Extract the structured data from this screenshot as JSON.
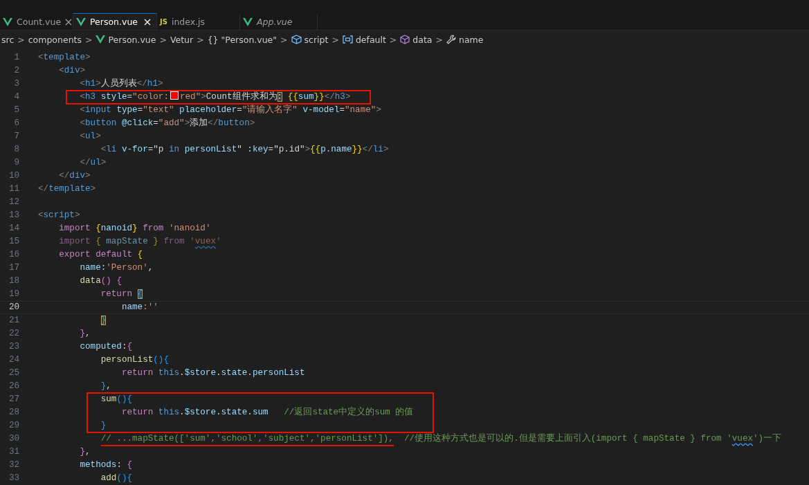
{
  "tabs": [
    {
      "label": "Count.vue",
      "kind": "vue",
      "selected": false,
      "preview": false,
      "closable": true
    },
    {
      "label": "Person.vue",
      "kind": "vue",
      "selected": true,
      "preview": false,
      "closable": true
    },
    {
      "label": "index.js",
      "kind": "js",
      "icon_text": "JS",
      "selected": false,
      "preview": false,
      "closable": false
    },
    {
      "label": "App.vue",
      "kind": "vue",
      "selected": false,
      "preview": true,
      "closable": false
    }
  ],
  "breadcrumb": [
    {
      "label": "src",
      "kind": "plain"
    },
    {
      "label": "components",
      "kind": "plain"
    },
    {
      "label": "Person.vue",
      "kind": "vue"
    },
    {
      "label": "Vetur",
      "kind": "plain"
    },
    {
      "label": "\"Person.vue\"",
      "kind": "plain",
      "icon_text": "{}"
    },
    {
      "label": "script",
      "kind": "cube"
    },
    {
      "label": "default",
      "kind": "module"
    },
    {
      "label": "data",
      "kind": "box"
    },
    {
      "label": "name",
      "kind": "wrench"
    }
  ],
  "separator": ">",
  "lines": [
    {
      "number": "1",
      "tokens": [
        {
          "kind": "p",
          "text": "<"
        },
        {
          "kind": "tag",
          "text": "template"
        },
        {
          "kind": "p",
          "text": ">"
        }
      ]
    },
    {
      "number": "2",
      "tokens": [
        {
          "kind": "p",
          "text": "    <"
        },
        {
          "kind": "tag",
          "text": "div"
        },
        {
          "kind": "p",
          "text": ">"
        }
      ]
    },
    {
      "number": "3",
      "tokens": [
        {
          "kind": "p",
          "text": "        <"
        },
        {
          "kind": "tag",
          "text": "h1"
        },
        {
          "kind": "p",
          "text": ">"
        },
        {
          "kind": "txt",
          "text": "人员列表"
        },
        {
          "kind": "p",
          "text": "</"
        },
        {
          "kind": "tag",
          "text": "h1"
        },
        {
          "kind": "p",
          "text": ">"
        }
      ]
    },
    {
      "number": "4",
      "boxed": true,
      "tokens": [
        {
          "kind": "p",
          "text": "        <"
        },
        {
          "kind": "tag",
          "text": "h3"
        },
        {
          "kind": "attr",
          "text": " style"
        },
        {
          "kind": "txt",
          "text": "="
        },
        {
          "kind": "str",
          "text": "\"color:"
        },
        {
          "kind": "swatch",
          "color": "#ff0000"
        },
        {
          "kind": "str",
          "text": "red\""
        },
        {
          "kind": "p",
          "text": ">"
        },
        {
          "kind": "txt",
          "text": "Count组件求和为"
        },
        {
          "kind": "txt",
          "text": ":",
          "matched": true
        },
        {
          "kind": "b1",
          "text": " {{"
        },
        {
          "kind": "attr",
          "text": "sum"
        },
        {
          "kind": "b1",
          "text": "}}"
        },
        {
          "kind": "p",
          "text": "</"
        },
        {
          "kind": "tag",
          "text": "h3"
        },
        {
          "kind": "p",
          "text": ">"
        }
      ]
    },
    {
      "number": "5",
      "tokens": [
        {
          "kind": "p",
          "text": "        <"
        },
        {
          "kind": "tag",
          "text": "input"
        },
        {
          "kind": "attr",
          "text": " type"
        },
        {
          "kind": "txt",
          "text": "="
        },
        {
          "kind": "str",
          "text": "\"text\""
        },
        {
          "kind": "attr",
          "text": " placeholder"
        },
        {
          "kind": "txt",
          "text": "="
        },
        {
          "kind": "str",
          "text": "\"请输入名字\""
        },
        {
          "kind": "attr",
          "text": " v-model"
        },
        {
          "kind": "txt",
          "text": "="
        },
        {
          "kind": "str",
          "text": "\"name\""
        },
        {
          "kind": "p",
          "text": ">"
        }
      ]
    },
    {
      "number": "6",
      "tokens": [
        {
          "kind": "p",
          "text": "        <"
        },
        {
          "kind": "tag",
          "text": "button"
        },
        {
          "kind": "attr",
          "text": " @click"
        },
        {
          "kind": "txt",
          "text": "="
        },
        {
          "kind": "str",
          "text": "\"add\""
        },
        {
          "kind": "p",
          "text": ">"
        },
        {
          "kind": "txt",
          "text": "添加"
        },
        {
          "kind": "p",
          "text": "</"
        },
        {
          "kind": "tag",
          "text": "button"
        },
        {
          "kind": "p",
          "text": ">"
        }
      ]
    },
    {
      "number": "7",
      "tokens": [
        {
          "kind": "p",
          "text": "        <"
        },
        {
          "kind": "tag",
          "text": "ul"
        },
        {
          "kind": "p",
          "text": ">"
        }
      ]
    },
    {
      "number": "8",
      "tokens": [
        {
          "kind": "p",
          "text": "            <"
        },
        {
          "kind": "tag",
          "text": "li"
        },
        {
          "kind": "attr",
          "text": " v-for"
        },
        {
          "kind": "txt",
          "text": "=\"p "
        },
        {
          "kind": "tag",
          "text": "in"
        },
        {
          "kind": "attr",
          "text": " personList"
        },
        {
          "kind": "txt",
          "text": "\" "
        },
        {
          "kind": "attr",
          "text": ":key"
        },
        {
          "kind": "txt",
          "text": "=\"p.id\""
        },
        {
          "kind": "p",
          "text": ">"
        },
        {
          "kind": "b1",
          "text": "{{"
        },
        {
          "kind": "attr",
          "text": "p.name"
        },
        {
          "kind": "b1",
          "text": "}}"
        },
        {
          "kind": "p",
          "text": "</"
        },
        {
          "kind": "tag",
          "text": "li"
        },
        {
          "kind": "p",
          "text": ">"
        }
      ]
    },
    {
      "number": "9",
      "tokens": [
        {
          "kind": "p",
          "text": "        </"
        },
        {
          "kind": "tag",
          "text": "ul"
        },
        {
          "kind": "p",
          "text": ">"
        }
      ]
    },
    {
      "number": "10",
      "tokens": [
        {
          "kind": "p",
          "text": "    </"
        },
        {
          "kind": "tag",
          "text": "div"
        },
        {
          "kind": "p",
          "text": ">"
        }
      ]
    },
    {
      "number": "11",
      "tokens": [
        {
          "kind": "p",
          "text": "</"
        },
        {
          "kind": "tag",
          "text": "template"
        },
        {
          "kind": "p",
          "text": ">"
        }
      ]
    },
    {
      "number": "12"
    },
    {
      "number": "13",
      "tokens": [
        {
          "kind": "p",
          "text": "<"
        },
        {
          "kind": "tag",
          "text": "script"
        },
        {
          "kind": "p",
          "text": ">"
        }
      ]
    },
    {
      "number": "14",
      "tokens": [
        {
          "kind": "kw",
          "text": "    import "
        },
        {
          "kind": "b1",
          "text": "{"
        },
        {
          "kind": "attr",
          "text": "nanoid"
        },
        {
          "kind": "b1",
          "text": "}"
        },
        {
          "kind": "kw",
          "text": " from "
        },
        {
          "kind": "str",
          "text": "'nanoid'"
        }
      ]
    },
    {
      "number": "15",
      "faded": true,
      "tokens": [
        {
          "kind": "kw",
          "text": "    import "
        },
        {
          "kind": "b1",
          "text": "{ "
        },
        {
          "kind": "attr",
          "text": "mapState"
        },
        {
          "kind": "b1",
          "text": " }"
        },
        {
          "kind": "kw",
          "text": " from "
        },
        {
          "kind": "str",
          "text": "'"
        },
        {
          "kind": "str",
          "text": "vuex",
          "squiggle": true
        },
        {
          "kind": "str",
          "text": "'"
        }
      ]
    },
    {
      "number": "16",
      "tokens": [
        {
          "kind": "kw",
          "text": "    export default "
        },
        {
          "kind": "b1",
          "text": "{"
        }
      ]
    },
    {
      "number": "17",
      "tokens": [
        {
          "kind": "attr",
          "text": "        name"
        },
        {
          "kind": "txt",
          "text": ":"
        },
        {
          "kind": "str",
          "text": "'Person'"
        },
        {
          "kind": "txt",
          "text": ","
        }
      ]
    },
    {
      "number": "18",
      "tokens": [
        {
          "kind": "fn",
          "text": "        data"
        },
        {
          "kind": "b2",
          "text": "()"
        },
        {
          "kind": "b2",
          "text": " {"
        }
      ]
    },
    {
      "number": "19",
      "tokens": [
        {
          "kind": "kw",
          "text": "            return "
        },
        {
          "kind": "b3",
          "text": "{",
          "matched": true
        }
      ]
    },
    {
      "number": "20",
      "current": true,
      "tokens": [
        {
          "kind": "attr",
          "text": "                name"
        },
        {
          "kind": "str",
          "text": ":''"
        }
      ]
    },
    {
      "number": "21",
      "tokens": [
        {
          "kind": "b3",
          "text": "            }",
          "matched": true
        }
      ]
    },
    {
      "number": "22",
      "tokens": [
        {
          "kind": "b2",
          "text": "        }"
        },
        {
          "kind": "txt",
          "text": ","
        }
      ]
    },
    {
      "number": "23",
      "tokens": [
        {
          "kind": "attr",
          "text": "        computed"
        },
        {
          "kind": "txt",
          "text": ":"
        },
        {
          "kind": "b2",
          "text": "{"
        }
      ]
    },
    {
      "number": "24",
      "tokens": [
        {
          "kind": "fn",
          "text": "            personList"
        },
        {
          "kind": "b3",
          "text": "(){"
        }
      ]
    },
    {
      "number": "25",
      "tokens": [
        {
          "kind": "kw",
          "text": "                return "
        },
        {
          "kind": "this",
          "text": "this"
        },
        {
          "kind": "txt",
          "text": "."
        },
        {
          "kind": "attr",
          "text": "$store"
        },
        {
          "kind": "txt",
          "text": "."
        },
        {
          "kind": "attr",
          "text": "state"
        },
        {
          "kind": "txt",
          "text": "."
        },
        {
          "kind": "attr",
          "text": "personList"
        }
      ]
    },
    {
      "number": "26",
      "tokens": [
        {
          "kind": "b3",
          "text": "            }"
        },
        {
          "kind": "txt",
          "text": ","
        }
      ]
    },
    {
      "number": "27",
      "boxed": true,
      "tokens": [
        {
          "kind": "fn",
          "text": "            sum"
        },
        {
          "kind": "b3",
          "text": "(){"
        }
      ]
    },
    {
      "number": "28",
      "boxed": true,
      "tokens": [
        {
          "kind": "kw",
          "text": "                return "
        },
        {
          "kind": "this",
          "text": "this"
        },
        {
          "kind": "txt",
          "text": "."
        },
        {
          "kind": "attr",
          "text": "$store"
        },
        {
          "kind": "txt",
          "text": "."
        },
        {
          "kind": "attr",
          "text": "state"
        },
        {
          "kind": "txt",
          "text": "."
        },
        {
          "kind": "attr",
          "text": "sum"
        },
        {
          "kind": "cm",
          "text": "   //返回state中定义的sum 的值"
        }
      ]
    },
    {
      "number": "29",
      "boxed": true,
      "tokens": [
        {
          "kind": "b3",
          "text": "            }"
        }
      ]
    },
    {
      "number": "30",
      "tokens": [
        {
          "kind": "cm",
          "text": "            // ...mapState(['sum','school','subject','personList']),",
          "underlined": true
        },
        {
          "kind": "cm",
          "text": "  //使用这种方式也是可以的.但是需要上面引入(import { mapState } from '"
        },
        {
          "kind": "cm",
          "text": "vuex",
          "squiggle": true
        },
        {
          "kind": "cm",
          "text": "')一下"
        }
      ]
    },
    {
      "number": "31",
      "tokens": [
        {
          "kind": "b2",
          "text": "        }"
        },
        {
          "kind": "txt",
          "text": ","
        }
      ]
    },
    {
      "number": "32",
      "tokens": [
        {
          "kind": "attr",
          "text": "        methods"
        },
        {
          "kind": "txt",
          "text": ": "
        },
        {
          "kind": "b2",
          "text": "{"
        }
      ]
    },
    {
      "number": "33",
      "tokens": [
        {
          "kind": "fn",
          "text": "            add"
        },
        {
          "kind": "b3",
          "text": "(){"
        }
      ]
    }
  ]
}
